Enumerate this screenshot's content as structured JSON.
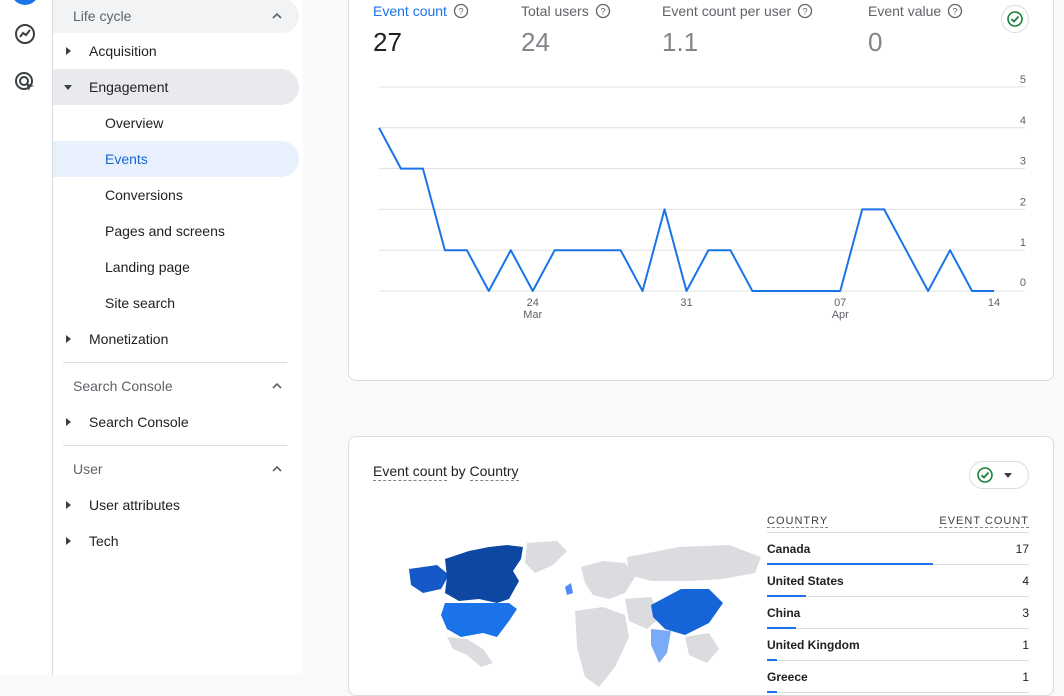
{
  "nav": {
    "lifecycle": {
      "title": "Life cycle",
      "acquisition": "Acquisition",
      "engagement": "Engagement",
      "engagement_items": [
        "Overview",
        "Events",
        "Conversions",
        "Pages and screens",
        "Landing page",
        "Site search"
      ],
      "monetization": "Monetization"
    },
    "search_console": {
      "title": "Search Console",
      "item": "Search Console"
    },
    "user": {
      "title": "User",
      "items": [
        "User attributes",
        "Tech"
      ]
    }
  },
  "metrics": [
    {
      "label": "Event count",
      "value": "27"
    },
    {
      "label": "Total users",
      "value": "24"
    },
    {
      "label": "Event count per user",
      "value": "1.1"
    },
    {
      "label": "Event value",
      "value": "0"
    }
  ],
  "colors": {
    "accent": "#1a73e8",
    "check": "#188038"
  },
  "icons": [
    "reports-icon",
    "explore-icon",
    "advertising-icon",
    "help-icon",
    "check-circle-icon",
    "chevron-up-icon",
    "dropdown-arrow-icon"
  ],
  "chart_data": {
    "type": "line",
    "y_ticks": [
      "5",
      "4",
      "3",
      "2",
      "1",
      "0"
    ],
    "x_ticks": [
      {
        "day": "24",
        "month": "Mar"
      },
      {
        "day": "31",
        "month": ""
      },
      {
        "day": "07",
        "month": "Apr"
      },
      {
        "day": "14",
        "month": ""
      }
    ],
    "x": [
      "Mar 17",
      "Mar 18",
      "Mar 19",
      "Mar 20",
      "Mar 21",
      "Mar 22",
      "Mar 23",
      "Mar 24",
      "Mar 25",
      "Mar 26",
      "Mar 27",
      "Mar 28",
      "Mar 29",
      "Mar 30",
      "Mar 31",
      "Apr 1",
      "Apr 2",
      "Apr 3",
      "Apr 4",
      "Apr 5",
      "Apr 6",
      "Apr 7",
      "Apr 8",
      "Apr 9",
      "Apr 10",
      "Apr 11",
      "Apr 12",
      "Apr 13",
      "Apr 14"
    ],
    "values": [
      4,
      3,
      3,
      1,
      1,
      0,
      1,
      0,
      1,
      1,
      1,
      1,
      0,
      2,
      0,
      1,
      1,
      0,
      0,
      0,
      0,
      0,
      2,
      2,
      1,
      0,
      1,
      0,
      0
    ],
    "ylim": [
      0,
      5
    ]
  },
  "map_card": {
    "title_metric": "Event count",
    "title_by": "by",
    "title_dim": "Country",
    "col_country": "COUNTRY",
    "col_count": "EVENT COUNT",
    "rows": [
      {
        "country": "Canada",
        "count": 17,
        "count_label": "17"
      },
      {
        "country": "United States",
        "count": 4,
        "count_label": "4"
      },
      {
        "country": "China",
        "count": 3,
        "count_label": "3"
      },
      {
        "country": "United Kingdom",
        "count": 1,
        "count_label": "1"
      },
      {
        "country": "Greece",
        "count": 1,
        "count_label": "1"
      }
    ]
  }
}
